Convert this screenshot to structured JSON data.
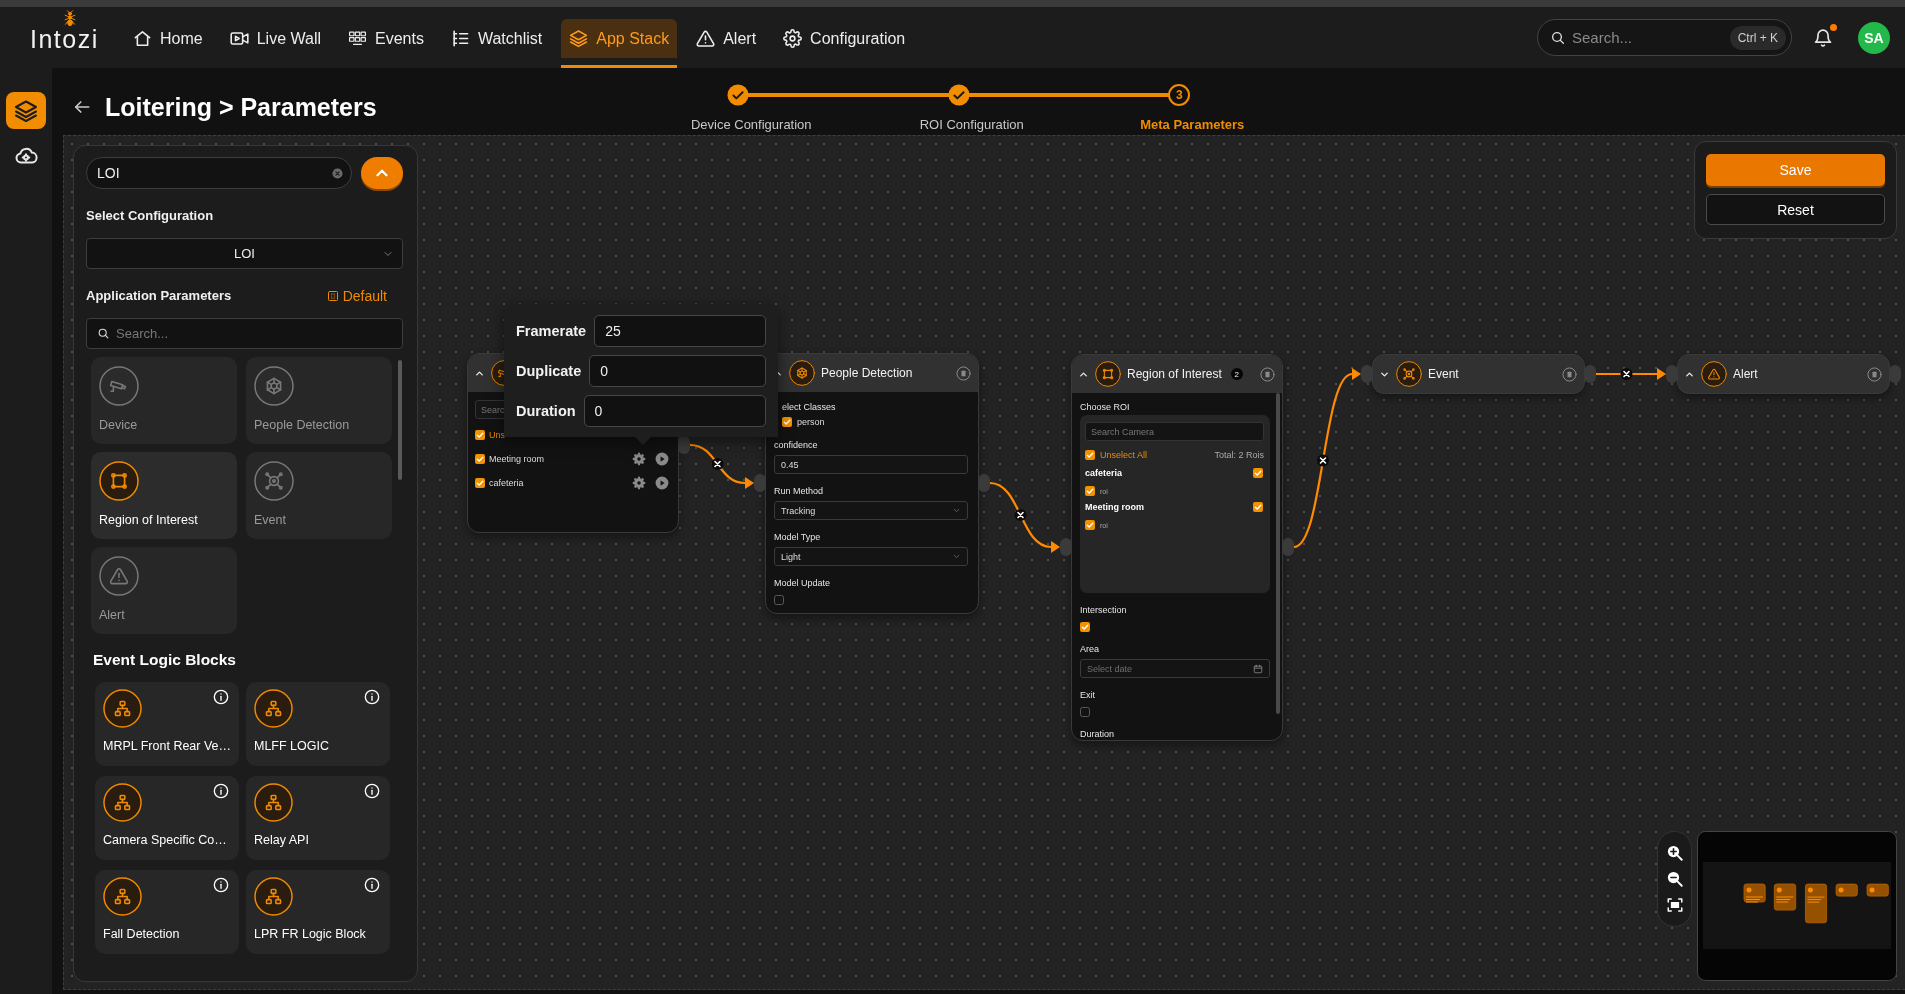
{
  "top_bar": {
    "logo": "Intozi",
    "nav": [
      {
        "label": "Home",
        "selected": false
      },
      {
        "label": "Live Wall",
        "selected": false
      },
      {
        "label": "Events",
        "selected": false
      },
      {
        "label": "Watchlist",
        "selected": false
      },
      {
        "label": "App Stack",
        "selected": true
      },
      {
        "label": "Alert",
        "selected": false
      },
      {
        "label": "Configuration",
        "selected": false
      }
    ],
    "search": {
      "placeholder": "Search...",
      "shortcut": "Ctrl + K"
    },
    "notifications": {
      "unread": true
    },
    "avatar": "SA"
  },
  "side_rail": [
    {
      "selected": true
    },
    {
      "selected": false
    }
  ],
  "page": {
    "title": "Loitering > Parameters"
  },
  "stepper": [
    {
      "label": "Device Configuration",
      "completed": true,
      "current": false
    },
    {
      "label": "ROI Configuration",
      "completed": true,
      "current": false
    },
    {
      "label": "Meta Parameters",
      "completed": false,
      "current": true,
      "number": "3"
    }
  ],
  "palette": {
    "search": {
      "value": "LOI"
    },
    "config_label": "Select Configuration",
    "config_value": "LOI",
    "params_title": "Application Parameters",
    "default_label": "Default",
    "params_search_placeholder": "Search...",
    "blocks": [
      {
        "kind": "device",
        "label": "Device",
        "selected": false
      },
      {
        "kind": "detection",
        "label": "People Detection",
        "selected": false
      },
      {
        "kind": "roi",
        "label": "Region of Interest",
        "selected": true
      },
      {
        "kind": "event",
        "label": "Event",
        "selected": false
      },
      {
        "kind": "alert",
        "label": "Alert",
        "selected": false
      }
    ],
    "logic_title": "Event Logic Blocks",
    "logic_blocks": [
      {
        "label": "MRPL Front Rear Ve…"
      },
      {
        "label": "MLFF LOGIC"
      },
      {
        "label": "Camera Specific Co…"
      },
      {
        "label": "Relay API"
      },
      {
        "label": "Fall Detection"
      },
      {
        "label": "LPR FR Logic Block"
      }
    ]
  },
  "canvas": {
    "nodes": [
      {
        "kind": "device",
        "expanded": true,
        "camera_list": {
          "search_placeholder": "Searc",
          "select_all": {
            "label": "Uns",
            "checked": true
          },
          "cameras": [
            {
              "name": "Meeting room",
              "checked": true
            },
            {
              "name": "cafeteria",
              "checked": true
            }
          ]
        }
      },
      {
        "kind": "detection",
        "title": "People Detection",
        "expanded": true,
        "fields": [
          {
            "kind": "checklist",
            "label": "elect Classes",
            "options": [
              {
                "label": "person",
                "checked": true
              }
            ]
          },
          {
            "kind": "number",
            "label": "confidence",
            "value": "0.45"
          },
          {
            "kind": "select",
            "label": "Run Method",
            "value": "Tracking"
          },
          {
            "kind": "select",
            "label": "Model Type",
            "value": "Light"
          },
          {
            "kind": "checkbox",
            "label": "Model Update",
            "checked": false
          }
        ]
      },
      {
        "kind": "roi",
        "title": "Region of Interest",
        "count": "2",
        "expanded": true,
        "roi_picker": {
          "label": "Choose ROI",
          "search_placeholder": "Search Camera",
          "select_all": {
            "label": "Unselect All",
            "checked": true
          },
          "total": "Total: 2 Rois",
          "cameras": [
            {
              "name": "cafeteria",
              "checked": true,
              "rois": [
                {
                  "label": "roi",
                  "checked": true
                }
              ]
            },
            {
              "name": "Meeting room",
              "checked": true,
              "rois": [
                {
                  "label": "roi",
                  "checked": true
                }
              ]
            }
          ]
        },
        "fields": [
          {
            "kind": "checkbox",
            "label": "Intersection",
            "checked": true
          },
          {
            "kind": "date",
            "label": "Area",
            "placeholder": "Select date"
          },
          {
            "kind": "checkbox",
            "label": "Exit",
            "checked": false
          },
          {
            "kind": "label",
            "label": "Duration"
          }
        ]
      },
      {
        "kind": "event",
        "title": "Event",
        "expanded": false
      },
      {
        "kind": "alert",
        "title": "Alert",
        "expanded": true
      }
    ],
    "popup": {
      "fields": [
        {
          "label": "Framerate",
          "value": "25"
        },
        {
          "label": "Duplicate",
          "value": "0"
        },
        {
          "label": "Duration",
          "value": "0"
        }
      ]
    }
  },
  "actions": [
    {
      "label": "Save",
      "kind": "primary"
    },
    {
      "label": "Reset",
      "kind": "secondary"
    }
  ]
}
